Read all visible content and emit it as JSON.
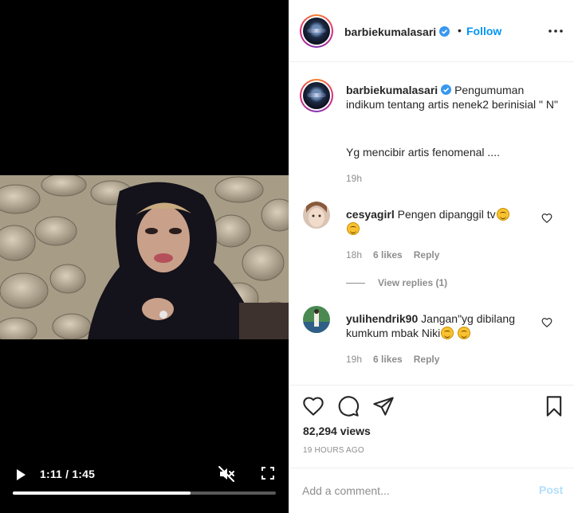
{
  "video": {
    "time_readout": "1:11 / 1:45",
    "progress": 0.676,
    "icons": {
      "play": "play-icon",
      "mute": "muted-speaker-icon",
      "fullscreen": "fullscreen-icon"
    }
  },
  "post": {
    "author": "barbiekumalasari",
    "follow_label": "Follow",
    "dot": "•",
    "caption": "Pengumuman indikum tentang artis nenek2 berinisial \" N\"",
    "caption_line2": "Yg mencibir artis fenomenal ....",
    "caption_time": "19h",
    "views": "82,294 views",
    "posted_ago": "19 HOURS AGO"
  },
  "comments": [
    {
      "username": "cesyagirl",
      "text": "Pengen dipanggil tv",
      "time": "18h",
      "likes": "6 likes",
      "reply_label": "Reply",
      "view_replies": "View replies (1)"
    },
    {
      "username": "yulihendrik90",
      "text": "Jangan\"yg dibilang kumkum mbak Niki",
      "time": "19h",
      "likes": "6 likes",
      "reply_label": "Reply"
    }
  ],
  "add_comment": {
    "placeholder": "Add a comment...",
    "post_label": "Post"
  },
  "colors": {
    "link_blue": "#0095f6",
    "post_disabled": "#b2dffc",
    "muted_text": "#8e8e8e",
    "verified_badge": "#3897f0"
  }
}
